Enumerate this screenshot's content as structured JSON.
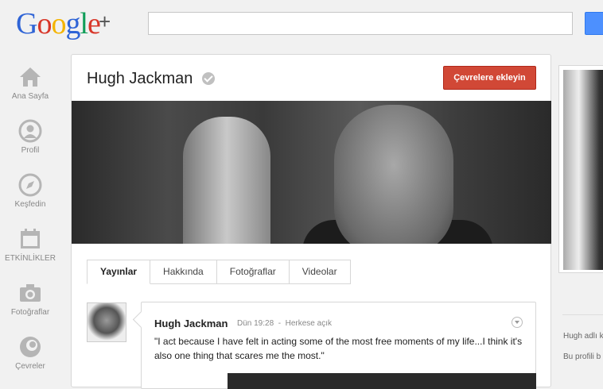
{
  "header": {
    "logo_letters": [
      "G",
      "o",
      "o",
      "g",
      "l",
      "e"
    ],
    "logo_plus": "+",
    "search_placeholder": ""
  },
  "nav": {
    "items": [
      {
        "label": "Ana Sayfa",
        "icon": "home-icon"
      },
      {
        "label": "Profil",
        "icon": "profile-icon"
      },
      {
        "label": "Keşfedin",
        "icon": "compass-icon"
      },
      {
        "label": "ETKİNLİKLER",
        "icon": "calendar-icon"
      },
      {
        "label": "Fotoğraflar",
        "icon": "camera-icon"
      },
      {
        "label": "Çevreler",
        "icon": "circles-icon"
      }
    ]
  },
  "profile": {
    "name": "Hugh Jackman",
    "add_button": "Çevrelere ekleyin",
    "tabs": [
      {
        "label": "Yayınlar",
        "active": true
      },
      {
        "label": "Hakkında",
        "active": false
      },
      {
        "label": "Fotoğraflar",
        "active": false
      },
      {
        "label": "Videolar",
        "active": false
      }
    ]
  },
  "post": {
    "author": "Hugh Jackman",
    "time": "Dün 19:28",
    "separator": "-",
    "visibility": "Herkese açık",
    "text": "\"I act because I have felt in acting some of the most free moments of my life...I think it's also one thing that scares me the most.\""
  },
  "sidebar": {
    "line1": "Hugh adlı k",
    "line2": "Bu profili b"
  },
  "colors": {
    "accent_red": "#d14836",
    "search_blue": "#4d90fe"
  }
}
